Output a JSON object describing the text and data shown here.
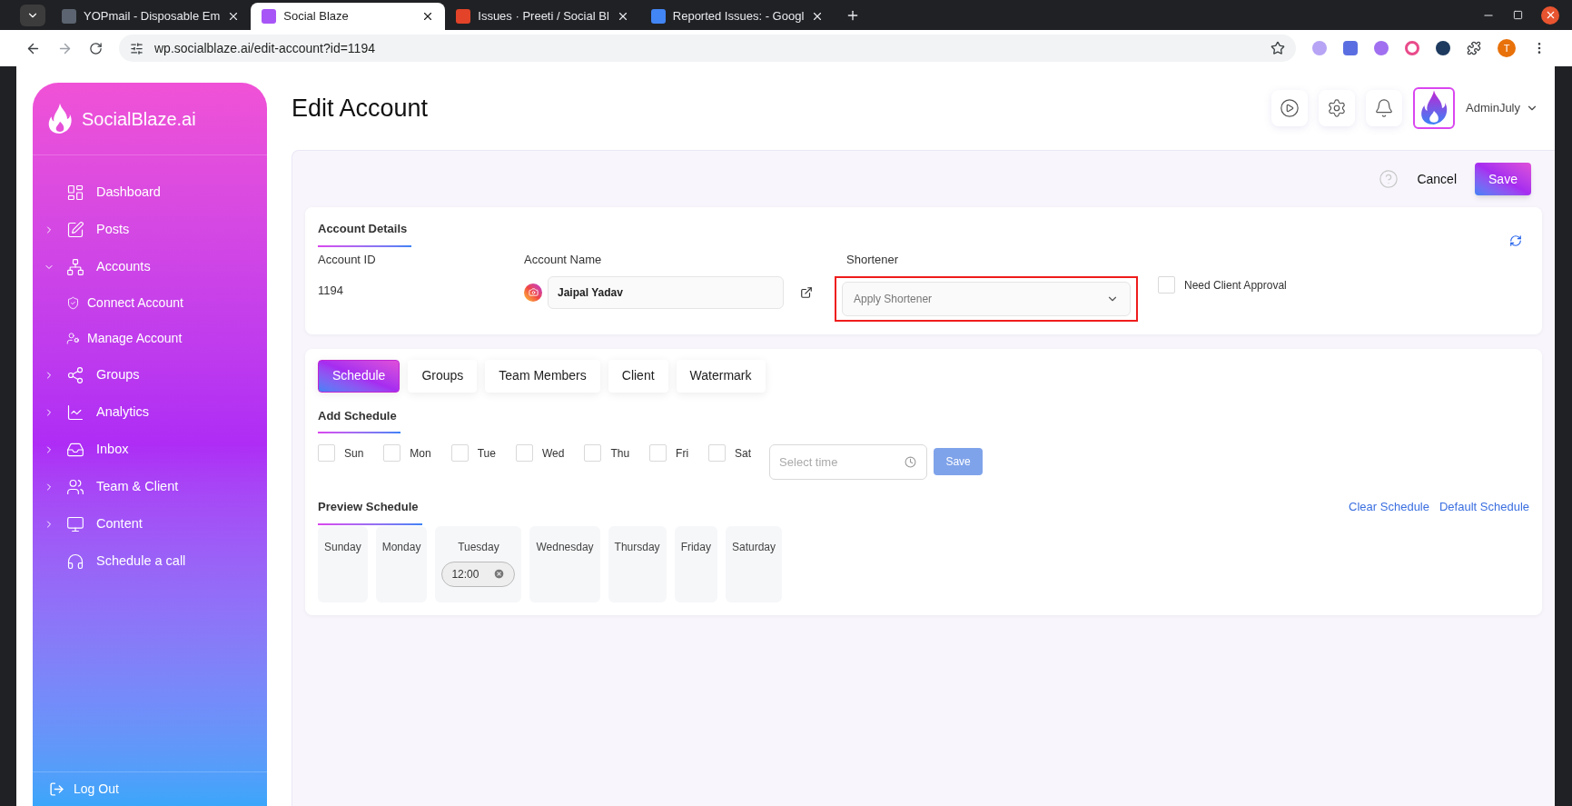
{
  "browser": {
    "tabs": [
      {
        "title": "YOPmail - Disposable Em",
        "selected": false,
        "color": "#5b6470"
      },
      {
        "title": "Social Blaze",
        "selected": true,
        "color": "#a855f7"
      },
      {
        "title": "Issues · Preeti / Social Bl",
        "selected": false,
        "color": "#e24329"
      },
      {
        "title": "Reported Issues: - Googl",
        "selected": false,
        "color": "#4285f4"
      }
    ],
    "url": "wp.socialblaze.ai/edit-account?id=1194",
    "profile_initial": "T"
  },
  "sidebar": {
    "brand": "SocialBlaze.ai",
    "items": [
      {
        "label": "Dashboard"
      },
      {
        "label": "Posts",
        "expanded": false
      },
      {
        "label": "Accounts",
        "expanded": true,
        "children": [
          {
            "label": "Connect Account"
          },
          {
            "label": "Manage Account"
          }
        ]
      },
      {
        "label": "Groups",
        "expanded": false
      },
      {
        "label": "Analytics",
        "expanded": false
      },
      {
        "label": "Inbox",
        "expanded": false
      },
      {
        "label": "Team & Client",
        "expanded": false
      },
      {
        "label": "Content",
        "expanded": false
      },
      {
        "label": "Schedule a call"
      }
    ],
    "logout": "Log Out"
  },
  "header": {
    "title": "Edit Account",
    "user": "AdminJuly"
  },
  "actions": {
    "cancel": "Cancel",
    "save": "Save"
  },
  "account_details": {
    "heading": "Account Details",
    "id_label": "Account ID",
    "id_value": "1194",
    "name_label": "Account Name",
    "name_value": "Jaipal Yadav",
    "shortener_label": "Shortener",
    "shortener_placeholder": "Apply Shortener",
    "shortener_highlighted": true,
    "approval_label": "Need Client Approval",
    "approval_checked": false
  },
  "tabs": [
    {
      "label": "Schedule",
      "selected": true
    },
    {
      "label": "Groups",
      "selected": false
    },
    {
      "label": "Team Members",
      "selected": false
    },
    {
      "label": "Client",
      "selected": false
    },
    {
      "label": "Watermark",
      "selected": false
    }
  ],
  "add_schedule": {
    "heading": "Add Schedule",
    "days": [
      {
        "label": "Sun",
        "checked": false
      },
      {
        "label": "Mon",
        "checked": false
      },
      {
        "label": "Tue",
        "checked": false
      },
      {
        "label": "Wed",
        "checked": false
      },
      {
        "label": "Thu",
        "checked": false
      },
      {
        "label": "Fri",
        "checked": false
      },
      {
        "label": "Sat",
        "checked": false
      }
    ],
    "time_placeholder": "Select time",
    "save": "Save"
  },
  "preview_schedule": {
    "heading": "Preview Schedule",
    "links": [
      "Clear Schedule",
      "Default Schedule"
    ],
    "days": [
      {
        "label": "Sunday"
      },
      {
        "label": "Monday"
      },
      {
        "label": "Tuesday",
        "slots": [
          "12:00"
        ]
      },
      {
        "label": "Wednesday"
      },
      {
        "label": "Thursday"
      },
      {
        "label": "Friday"
      },
      {
        "label": "Saturday"
      }
    ]
  }
}
